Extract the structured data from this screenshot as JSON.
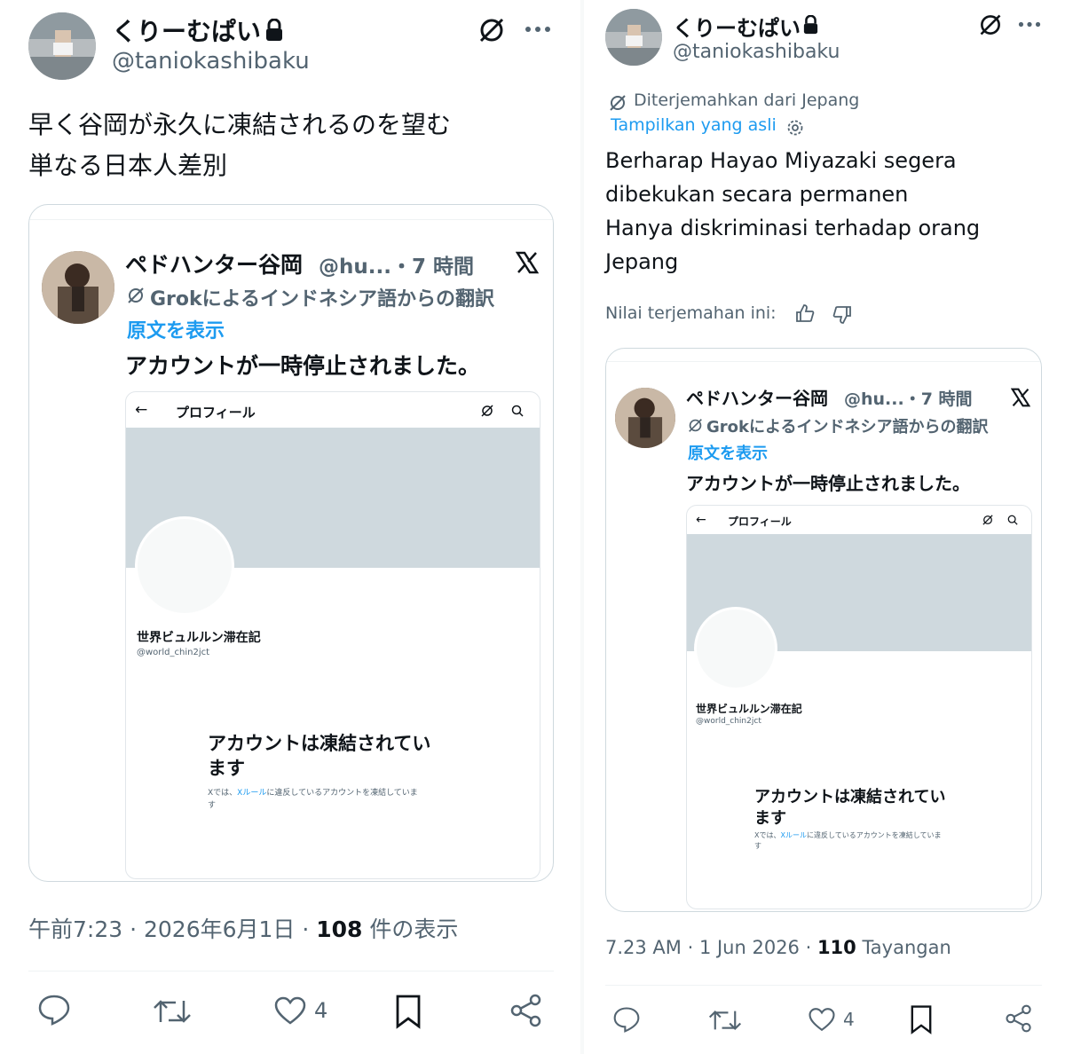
{
  "left": {
    "author_name": "くりーむぱい",
    "author_handle": "@taniokashibaku",
    "tweet_lines": [
      "早く谷岡が永久に凍結されるのを望む",
      "単なる日本人差別"
    ],
    "quote": {
      "name": "ペドハンター谷岡",
      "handle_time": "@hu...・7 時間",
      "grok_line": "Grokによるインドネシア語からの翻訳",
      "show_original": "原文を表示",
      "text": "アカウントが一時停止されました。",
      "inner": {
        "back": "←",
        "title": "プロフィール",
        "profile_name": "世界ビュルルン滞在記",
        "profile_handle": "@world_chin2jct",
        "suspended_line1": "アカウントは凍結されてい",
        "suspended_line2": "ます",
        "note_pre": "Xでは、",
        "note_link": "Xルール",
        "note_post": "に違反しているアカウントを凍結していま",
        "note_tail": "す"
      }
    },
    "meta_time": "午前7:23 · 2026年6月1日 · ",
    "meta_views": "108",
    "meta_views_label": " 件の表示",
    "like_count": "4"
  },
  "right": {
    "author_name": "くりーむぱい",
    "author_handle": "@taniokashibaku",
    "translated_from": "Diterjemahkan dari Jepang",
    "show_original": "Tampilkan yang asli",
    "tweet_lines": [
      "Berharap Hayao Miyazaki segera",
      "dibekukan secara permanen",
      "Hanya diskriminasi terhadap orang",
      "Jepang"
    ],
    "rate_translation": "Nilai terjemahan ini:",
    "quote": {
      "name": "ペドハンター谷岡",
      "handle_time": "@hu...・7 時間",
      "grok_line": "Grokによるインドネシア語からの翻訳",
      "show_original": "原文を表示",
      "text": "アカウントが一時停止されました。",
      "inner": {
        "back": "←",
        "title": "プロフィール",
        "profile_name": "世界ビュルルン滞在記",
        "profile_handle": "@world_chin2jct",
        "suspended_line1": "アカウントは凍結されてい",
        "suspended_line2": "ます",
        "note_pre": "Xでは、",
        "note_link": "Xルール",
        "note_post": "に違反しているアカウントを凍結していま",
        "note_tail": "す"
      }
    },
    "meta_time": "7.23 AM · 1 Jun 2026 · ",
    "meta_views": "110",
    "meta_views_label": " Tayangan",
    "like_count": "4"
  },
  "colors": {
    "accent": "#1d9bf0",
    "muted": "#536471",
    "text": "#0f1419",
    "border": "#cfd9de",
    "banner": "#cfd9de"
  },
  "icons": [
    "lock-icon",
    "grok-icon",
    "more-icon",
    "x-logo-icon",
    "search-icon",
    "reply-icon",
    "retweet-icon",
    "like-icon",
    "bookmark-icon",
    "share-icon",
    "settings-icon",
    "thumbs-up-icon",
    "thumbs-down-icon"
  ]
}
